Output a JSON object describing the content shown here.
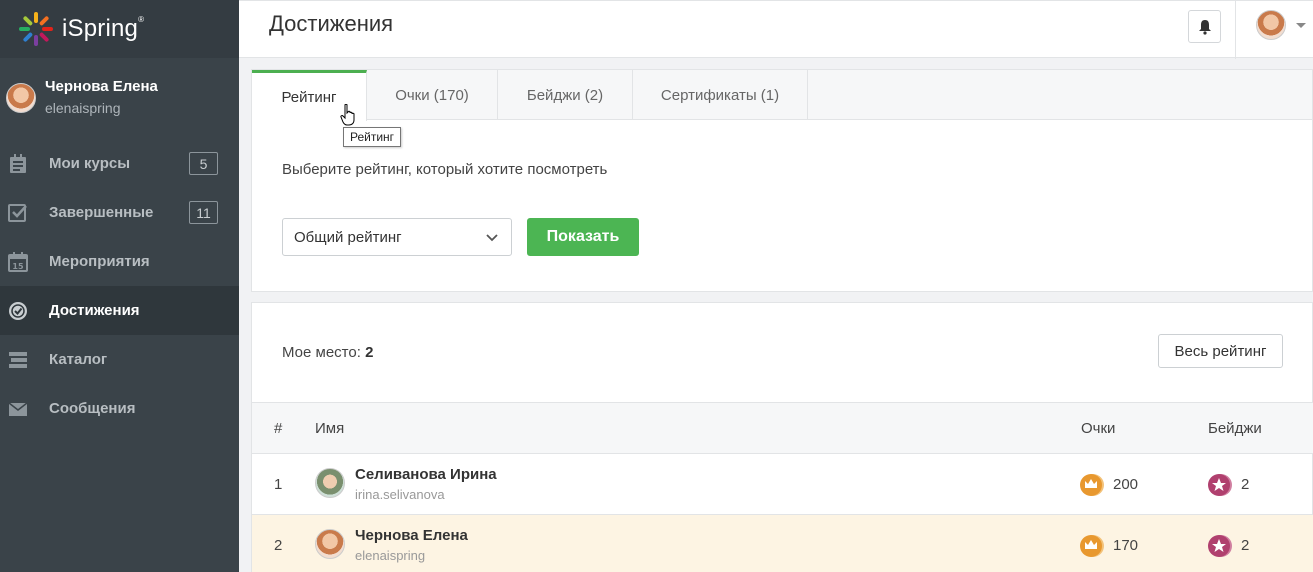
{
  "brand": {
    "name": "iSpring",
    "mark": "®"
  },
  "user": {
    "name": "Чернова Елена",
    "login": "elenaispring"
  },
  "nav": [
    {
      "label": "Мои курсы",
      "icon": "courses-icon",
      "count": "5"
    },
    {
      "label": "Завершенные",
      "icon": "completed-check-icon",
      "count": "11"
    },
    {
      "label": "Мероприятия",
      "icon": "calendar-icon",
      "count": null
    },
    {
      "label": "Достижения",
      "icon": "achievement-medal-icon",
      "count": null,
      "active": true
    },
    {
      "label": "Каталог",
      "icon": "catalog-icon",
      "count": null
    },
    {
      "label": "Сообщения",
      "icon": "envelope-icon",
      "count": null
    }
  ],
  "header": {
    "title": "Достижения"
  },
  "tabs": [
    {
      "label": "Рейтинг",
      "active": true
    },
    {
      "label": "Очки (170)"
    },
    {
      "label": "Бейджи (2)"
    },
    {
      "label": "Сертификаты (1)"
    }
  ],
  "tooltip": "Рейтинг",
  "rating": {
    "prompt": "Выберите рейтинг, который хотите посмотреть",
    "select_value": "Общий рейтинг",
    "show_button": "Показать"
  },
  "leaderboard": {
    "my_place_label": "Мое место:",
    "my_place_value": "2",
    "all_button": "Весь рейтинг",
    "columns": {
      "num": "#",
      "name": "Имя",
      "points": "Очки",
      "badges": "Бейджи"
    },
    "rows": [
      {
        "num": "1",
        "name": "Селиванова Ирина",
        "login": "irina.selivanova",
        "points": "200",
        "badges": "2"
      },
      {
        "num": "2",
        "name": "Чернова Елена",
        "login": "elenaispring",
        "points": "170",
        "badges": "2",
        "current": true
      }
    ]
  },
  "colors": {
    "sidebar": "#3a4349",
    "accent": "#4cb553",
    "highlight_row": "#fdf4e3"
  }
}
